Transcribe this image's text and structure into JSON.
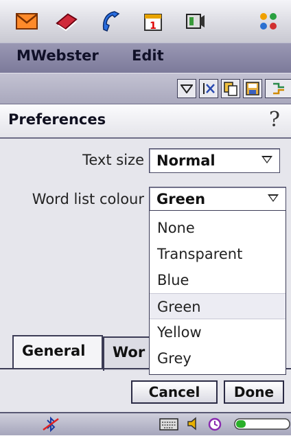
{
  "appbar": {
    "icons": [
      {
        "name": "messaging-icon",
        "glyph": "✉",
        "color": "#e85a00"
      },
      {
        "name": "contacts-book-icon",
        "glyph": "📕",
        "color": "#c02030"
      },
      {
        "name": "phone-icon",
        "glyph": "✆",
        "color": "#1e5fd0"
      },
      {
        "name": "calendar-icon",
        "glyph": "📅",
        "color": "#d0a000"
      },
      {
        "name": "media-icon",
        "glyph": "⏏",
        "color": "#2a8a2a"
      },
      {
        "name": "apps-grid-icon",
        "glyph": "⁘",
        "color": "#209040"
      }
    ]
  },
  "menubar": {
    "app_menu": "MWebster",
    "edit_menu": "Edit"
  },
  "toolbar": {
    "icons": [
      "dropdown-icon",
      "clear-icon",
      "copy-icon",
      "save-icon",
      "more-icon"
    ]
  },
  "header": {
    "title": "Preferences",
    "help": "?"
  },
  "form": {
    "text_size_label": "Text size",
    "text_size_value": "Normal",
    "word_list_colour_label": "Word list colour",
    "word_list_colour_value": "Green"
  },
  "dropdown": {
    "options": [
      "None",
      "Transparent",
      "Blue",
      "Green",
      "Yellow",
      "Grey"
    ],
    "selected": "Green"
  },
  "tabs": {
    "general": "General",
    "second": "Wor"
  },
  "buttons": {
    "cancel": "Cancel",
    "done": "Done"
  },
  "statusbar": {
    "icons": [
      "bluetooth-off-icon",
      "keyboard-icon",
      "volume-icon",
      "alarm-clock-icon",
      "battery-icon"
    ]
  },
  "colors": {
    "menubar": "#8a88a8",
    "selection": "#ececf3"
  }
}
